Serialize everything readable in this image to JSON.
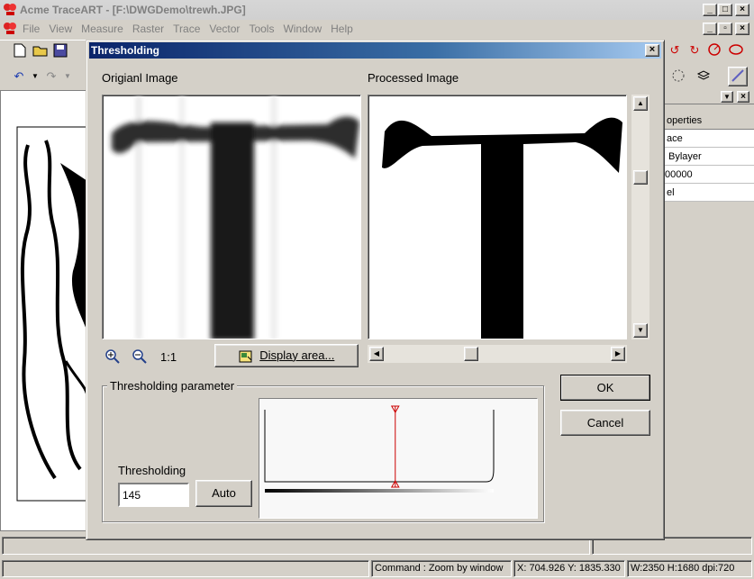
{
  "app": {
    "title": "Acme TraceART - [F:\\DWGDemo\\trewh.JPG]",
    "menu": [
      "File",
      "View",
      "Measure",
      "Raster",
      "Trace",
      "Vector",
      "Tools",
      "Window",
      "Help"
    ]
  },
  "right_panel": {
    "rows": [
      "operties",
      "ace",
      "Bylayer",
      "00000",
      "el"
    ]
  },
  "status": {
    "command": "Command : Zoom by window",
    "coords": "X: 704.926 Y: 1835.330",
    "image_info": "W:2350 H:1680 dpi:720"
  },
  "dialog": {
    "title": "Thresholding",
    "close": "×",
    "original_label": "Origianl Image",
    "processed_label": "Processed Image",
    "zoom_ratio": "1:1",
    "display_area_label": "Display area...",
    "group_title": "Thresholding parameter",
    "threshold_label": "Thresholding",
    "threshold_value": "145",
    "auto_label": "Auto",
    "ok_label": "OK",
    "cancel_label": "Cancel",
    "threshold_fraction": 0.57,
    "horizontal_scroll_fraction": 0.38,
    "vertical_scroll_fraction": 0.3
  },
  "icons": {
    "zoom_in": "zoom-in-icon",
    "zoom_out": "zoom-out-icon"
  }
}
